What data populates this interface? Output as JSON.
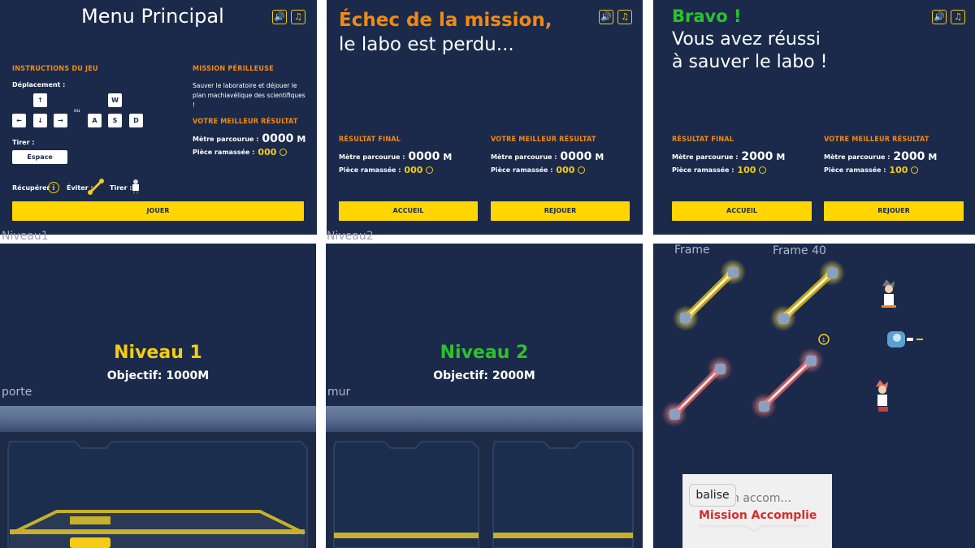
{
  "menu": {
    "title": "Menu Principal",
    "instructions_title": "INSTRUCTIONS DU JEU",
    "deplacement_label": "Déplacement :",
    "ou": "ou",
    "keys_arrows": [
      "↑",
      "←",
      "↓",
      "→"
    ],
    "keys_letters": [
      "W",
      "A",
      "S",
      "D"
    ],
    "tirer_label": "Tirer :",
    "espace": "Espace",
    "recuperer_label": "Récupérer :",
    "eviter_label": "Éviter :",
    "tirer_label2": "Tirer :",
    "mission_title": "MISSION PÉRILLEUSE",
    "mission_text": "Sauver le laboratoire et déjouer le plan machiavélique des scientifiques !",
    "best_title": "VOTRE MEILLEUR RÉSULTAT",
    "metre_label": "Mètre parcourue :",
    "metre_value": "0000",
    "metre_unit": "M",
    "piece_label": "Pièce ramassée :",
    "piece_value": "000",
    "jouer": "JOUER"
  },
  "fail": {
    "title_line1": "Échec de la mission,",
    "title_line2": "le labo est perdu...",
    "final_title": "RÉSULTAT FINAL",
    "best_title": "VOTRE MEILLEUR RÉSULTAT",
    "metre_label": "Mètre parcourue :",
    "metre_final": "0000",
    "metre_best": "0000",
    "unit": "M",
    "piece_label": "Pièce ramassée :",
    "piece_final": "000",
    "piece_best": "000",
    "accueil": "ACCUEIL",
    "rejouer": "REJOUER"
  },
  "win": {
    "title_line1": "Bravo !",
    "title_line2": "Vous avez réussi",
    "title_line3": "à sauver le labo !",
    "final_title": "RÉSULTAT FINAL",
    "best_title": "VOTRE MEILLEUR RÉSULTAT",
    "metre_label": "Mètre parcourue :",
    "metre_final": "2000",
    "metre_best": "2000",
    "unit": "M",
    "piece_label": "Pièce ramassée :",
    "piece_final": "100",
    "piece_best": "100",
    "accueil": "ACCUEIL",
    "rejouer": "REJOUER"
  },
  "grid_labels": {
    "niveau1": "Niveau1",
    "niveau2": "Niveau2",
    "porte": "porte",
    "mur": "mur"
  },
  "level1": {
    "title": "Niveau 1",
    "objectif": "Objectif: 1000M"
  },
  "level2": {
    "title": "Niveau 2",
    "objectif": "Objectif: 2000M"
  },
  "sprites": {
    "frame": "Frame",
    "frame40": "Frame 40",
    "balise": "balise",
    "mission_ghost": "n accom...",
    "mission": "Mission Accomplie"
  },
  "colors": {
    "panel_bg": "#1b2a4a",
    "orange": "#f08a14",
    "yellow": "#f5cc14",
    "green": "#2ec02e",
    "button": "#ffd600",
    "red": "#d62d2d"
  }
}
